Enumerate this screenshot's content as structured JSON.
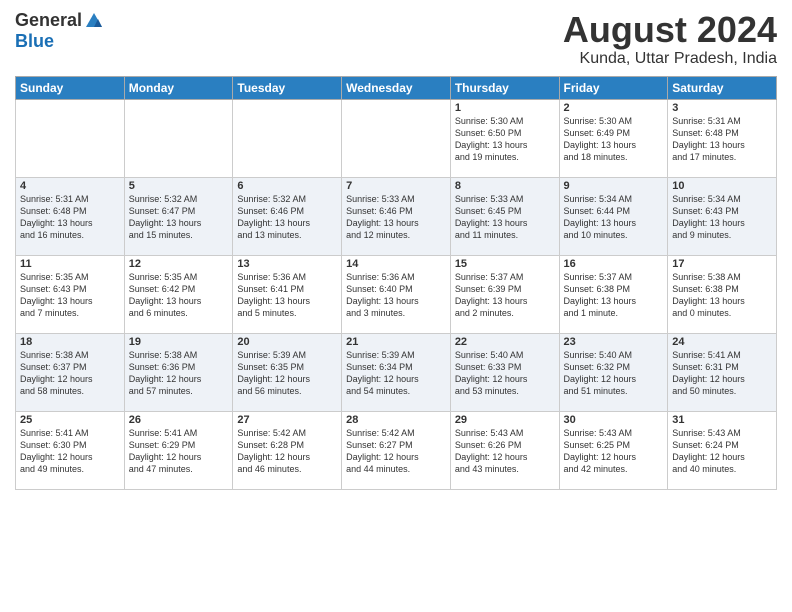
{
  "logo": {
    "general": "General",
    "blue": "Blue"
  },
  "header": {
    "month_year": "August 2024",
    "location": "Kunda, Uttar Pradesh, India"
  },
  "weekdays": [
    "Sunday",
    "Monday",
    "Tuesday",
    "Wednesday",
    "Thursday",
    "Friday",
    "Saturday"
  ],
  "weeks": [
    [
      {
        "day": "",
        "info": ""
      },
      {
        "day": "",
        "info": ""
      },
      {
        "day": "",
        "info": ""
      },
      {
        "day": "",
        "info": ""
      },
      {
        "day": "1",
        "info": "Sunrise: 5:30 AM\nSunset: 6:50 PM\nDaylight: 13 hours\nand 19 minutes."
      },
      {
        "day": "2",
        "info": "Sunrise: 5:30 AM\nSunset: 6:49 PM\nDaylight: 13 hours\nand 18 minutes."
      },
      {
        "day": "3",
        "info": "Sunrise: 5:31 AM\nSunset: 6:48 PM\nDaylight: 13 hours\nand 17 minutes."
      }
    ],
    [
      {
        "day": "4",
        "info": "Sunrise: 5:31 AM\nSunset: 6:48 PM\nDaylight: 13 hours\nand 16 minutes."
      },
      {
        "day": "5",
        "info": "Sunrise: 5:32 AM\nSunset: 6:47 PM\nDaylight: 13 hours\nand 15 minutes."
      },
      {
        "day": "6",
        "info": "Sunrise: 5:32 AM\nSunset: 6:46 PM\nDaylight: 13 hours\nand 13 minutes."
      },
      {
        "day": "7",
        "info": "Sunrise: 5:33 AM\nSunset: 6:46 PM\nDaylight: 13 hours\nand 12 minutes."
      },
      {
        "day": "8",
        "info": "Sunrise: 5:33 AM\nSunset: 6:45 PM\nDaylight: 13 hours\nand 11 minutes."
      },
      {
        "day": "9",
        "info": "Sunrise: 5:34 AM\nSunset: 6:44 PM\nDaylight: 13 hours\nand 10 minutes."
      },
      {
        "day": "10",
        "info": "Sunrise: 5:34 AM\nSunset: 6:43 PM\nDaylight: 13 hours\nand 9 minutes."
      }
    ],
    [
      {
        "day": "11",
        "info": "Sunrise: 5:35 AM\nSunset: 6:43 PM\nDaylight: 13 hours\nand 7 minutes."
      },
      {
        "day": "12",
        "info": "Sunrise: 5:35 AM\nSunset: 6:42 PM\nDaylight: 13 hours\nand 6 minutes."
      },
      {
        "day": "13",
        "info": "Sunrise: 5:36 AM\nSunset: 6:41 PM\nDaylight: 13 hours\nand 5 minutes."
      },
      {
        "day": "14",
        "info": "Sunrise: 5:36 AM\nSunset: 6:40 PM\nDaylight: 13 hours\nand 3 minutes."
      },
      {
        "day": "15",
        "info": "Sunrise: 5:37 AM\nSunset: 6:39 PM\nDaylight: 13 hours\nand 2 minutes."
      },
      {
        "day": "16",
        "info": "Sunrise: 5:37 AM\nSunset: 6:38 PM\nDaylight: 13 hours\nand 1 minute."
      },
      {
        "day": "17",
        "info": "Sunrise: 5:38 AM\nSunset: 6:38 PM\nDaylight: 13 hours\nand 0 minutes."
      }
    ],
    [
      {
        "day": "18",
        "info": "Sunrise: 5:38 AM\nSunset: 6:37 PM\nDaylight: 12 hours\nand 58 minutes."
      },
      {
        "day": "19",
        "info": "Sunrise: 5:38 AM\nSunset: 6:36 PM\nDaylight: 12 hours\nand 57 minutes."
      },
      {
        "day": "20",
        "info": "Sunrise: 5:39 AM\nSunset: 6:35 PM\nDaylight: 12 hours\nand 56 minutes."
      },
      {
        "day": "21",
        "info": "Sunrise: 5:39 AM\nSunset: 6:34 PM\nDaylight: 12 hours\nand 54 minutes."
      },
      {
        "day": "22",
        "info": "Sunrise: 5:40 AM\nSunset: 6:33 PM\nDaylight: 12 hours\nand 53 minutes."
      },
      {
        "day": "23",
        "info": "Sunrise: 5:40 AM\nSunset: 6:32 PM\nDaylight: 12 hours\nand 51 minutes."
      },
      {
        "day": "24",
        "info": "Sunrise: 5:41 AM\nSunset: 6:31 PM\nDaylight: 12 hours\nand 50 minutes."
      }
    ],
    [
      {
        "day": "25",
        "info": "Sunrise: 5:41 AM\nSunset: 6:30 PM\nDaylight: 12 hours\nand 49 minutes."
      },
      {
        "day": "26",
        "info": "Sunrise: 5:41 AM\nSunset: 6:29 PM\nDaylight: 12 hours\nand 47 minutes."
      },
      {
        "day": "27",
        "info": "Sunrise: 5:42 AM\nSunset: 6:28 PM\nDaylight: 12 hours\nand 46 minutes."
      },
      {
        "day": "28",
        "info": "Sunrise: 5:42 AM\nSunset: 6:27 PM\nDaylight: 12 hours\nand 44 minutes."
      },
      {
        "day": "29",
        "info": "Sunrise: 5:43 AM\nSunset: 6:26 PM\nDaylight: 12 hours\nand 43 minutes."
      },
      {
        "day": "30",
        "info": "Sunrise: 5:43 AM\nSunset: 6:25 PM\nDaylight: 12 hours\nand 42 minutes."
      },
      {
        "day": "31",
        "info": "Sunrise: 5:43 AM\nSunset: 6:24 PM\nDaylight: 12 hours\nand 40 minutes."
      }
    ]
  ]
}
